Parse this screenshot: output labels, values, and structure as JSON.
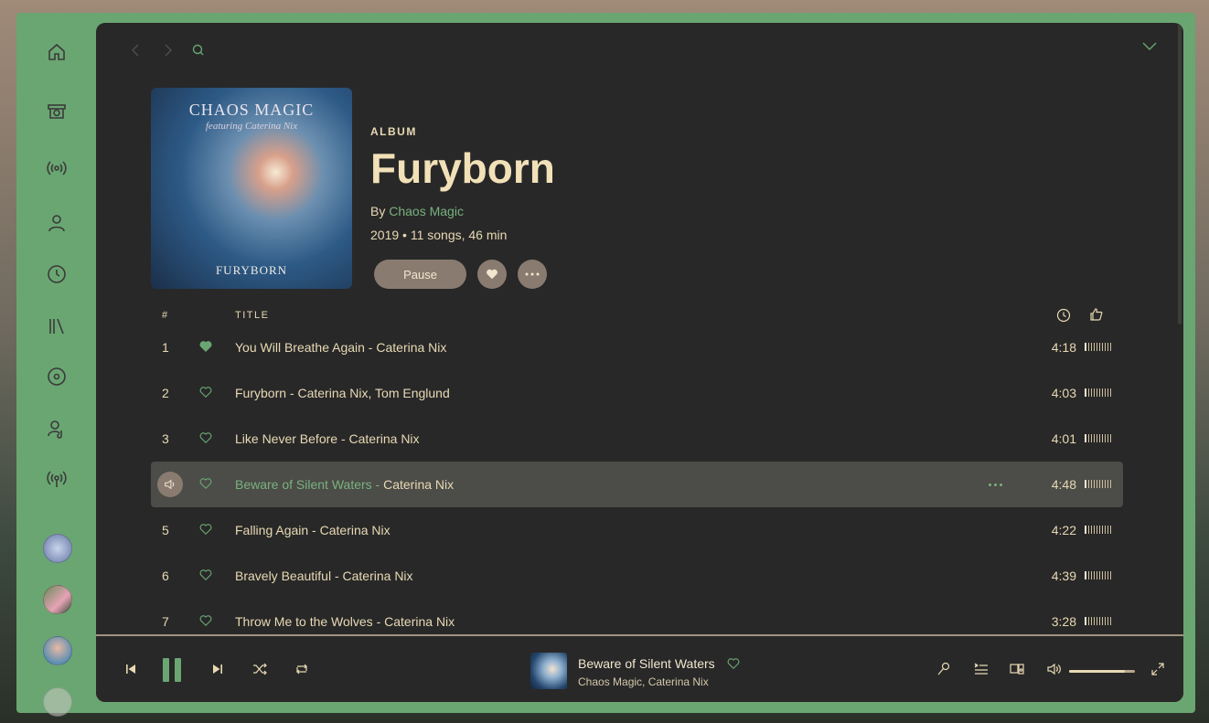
{
  "album": {
    "type_label": "ALBUM",
    "title": "Furyborn",
    "by_prefix": "By",
    "artist": "Chaos Magic",
    "meta": "2019 • 11 songs, 46 min",
    "cover_text": {
      "band": "CHAOS MAGIC",
      "featuring": "featuring Caterina Nix",
      "album": "FURYBORN"
    }
  },
  "actions": {
    "pause_label": "Pause",
    "liked": true
  },
  "tracklist": {
    "header_num": "#",
    "header_title": "TITLE",
    "rows": [
      {
        "num": "1",
        "song": "You Will Breathe Again",
        "artists": "Caterina Nix",
        "duration": "4:18",
        "liked": true,
        "playing": false
      },
      {
        "num": "2",
        "song": "Furyborn",
        "artists": "Caterina Nix, Tom Englund",
        "duration": "4:03",
        "liked": false,
        "playing": false
      },
      {
        "num": "3",
        "song": "Like Never Before",
        "artists": "Caterina Nix",
        "duration": "4:01",
        "liked": false,
        "playing": false
      },
      {
        "num": "4",
        "song": "Beware of Silent Waters",
        "artists": "Caterina Nix",
        "duration": "4:48",
        "liked": false,
        "playing": true
      },
      {
        "num": "5",
        "song": "Falling Again",
        "artists": "Caterina Nix",
        "duration": "4:22",
        "liked": false,
        "playing": false
      },
      {
        "num": "6",
        "song": "Bravely Beautiful",
        "artists": "Caterina Nix",
        "duration": "4:39",
        "liked": false,
        "playing": false
      },
      {
        "num": "7",
        "song": "Throw Me to the Wolves",
        "artists": "Caterina Nix",
        "duration": "3:28",
        "liked": false,
        "playing": false
      }
    ]
  },
  "now_playing": {
    "title": "Beware of Silent Waters",
    "artists": "Chaos Magic, Caterina Nix",
    "volume": 0.85
  },
  "colors": {
    "accent": "#6aa672",
    "text": "#e8d9b4",
    "background": "#282828",
    "button": "#8a7b70"
  },
  "sidebar_icons": [
    "home-icon",
    "marketplace-icon",
    "podcast-icon",
    "profile-icon",
    "recent-icon",
    "library-icon",
    "album-icon",
    "artist-icon",
    "radio-icon"
  ]
}
